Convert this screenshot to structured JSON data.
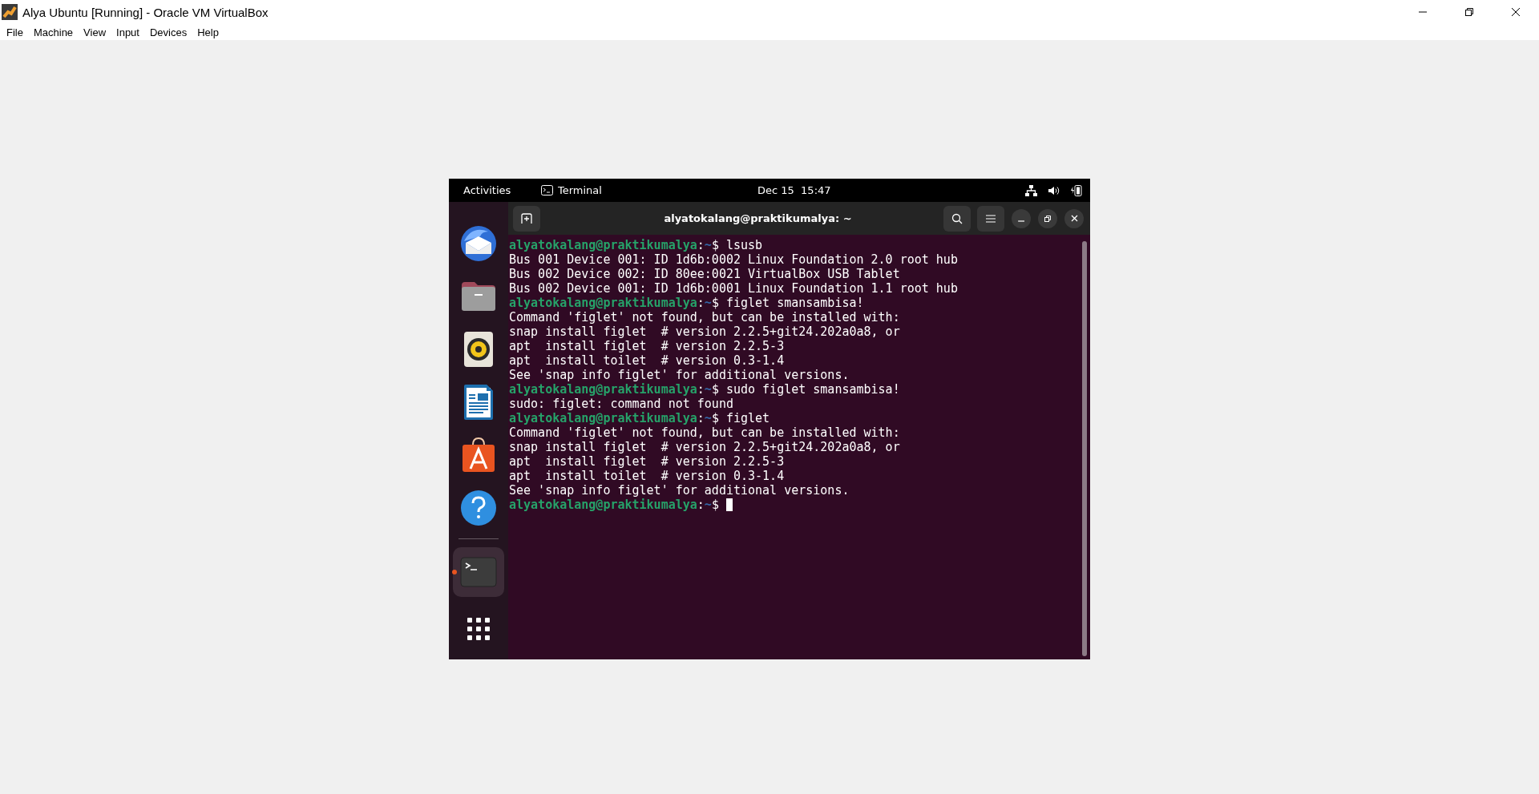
{
  "window": {
    "title": "Alya Ubuntu [Running] - Oracle VM VirtualBox"
  },
  "menu": [
    "File",
    "Machine",
    "View",
    "Input",
    "Devices",
    "Help"
  ],
  "topbar": {
    "activities": "Activities",
    "app": "Terminal",
    "clock": "Dec 15  15:47"
  },
  "dock": [
    {
      "kind": "mail",
      "selected": false
    },
    {
      "kind": "files",
      "selected": false
    },
    {
      "kind": "music",
      "selected": false
    },
    {
      "kind": "writer",
      "selected": false
    },
    {
      "kind": "store",
      "selected": false
    },
    {
      "kind": "help",
      "selected": false
    },
    {
      "kind": "terminal",
      "selected": true
    },
    {
      "kind": "apps",
      "selected": false
    }
  ],
  "terminal": {
    "title": "alyatokalang@praktikumalya: ~",
    "lines": [
      {
        "kind": "prompt",
        "user": "alyatokalang@praktikumalya",
        "sep": ":",
        "path": "~",
        "symbol": "$",
        "command": "lsusb"
      },
      {
        "kind": "output",
        "text": "Bus 001 Device 001: ID 1d6b:0002 Linux Foundation 2.0 root hub"
      },
      {
        "kind": "output",
        "text": "Bus 002 Device 002: ID 80ee:0021 VirtualBox USB Tablet"
      },
      {
        "kind": "output",
        "text": "Bus 002 Device 001: ID 1d6b:0001 Linux Foundation 1.1 root hub"
      },
      {
        "kind": "prompt",
        "user": "alyatokalang@praktikumalya",
        "sep": ":",
        "path": "~",
        "symbol": "$",
        "command": "figlet smansambisa!"
      },
      {
        "kind": "output",
        "text": "Command 'figlet' not found, but can be installed with:"
      },
      {
        "kind": "output",
        "text": "snap install figlet  # version 2.2.5+git24.202a0a8, or"
      },
      {
        "kind": "output",
        "text": "apt  install figlet  # version 2.2.5-3"
      },
      {
        "kind": "output",
        "text": "apt  install toilet  # version 0.3-1.4"
      },
      {
        "kind": "output",
        "text": "See 'snap info figlet' for additional versions."
      },
      {
        "kind": "prompt",
        "user": "alyatokalang@praktikumalya",
        "sep": ":",
        "path": "~",
        "symbol": "$",
        "command": "sudo figlet smansambisa!"
      },
      {
        "kind": "output",
        "text": "sudo: figlet: command not found"
      },
      {
        "kind": "prompt",
        "user": "alyatokalang@praktikumalya",
        "sep": ":",
        "path": "~",
        "symbol": "$",
        "command": "figlet"
      },
      {
        "kind": "output",
        "text": "Command 'figlet' not found, but can be installed with:"
      },
      {
        "kind": "output",
        "text": "snap install figlet  # version 2.2.5+git24.202a0a8, or"
      },
      {
        "kind": "output",
        "text": "apt  install figlet  # version 2.2.5-3"
      },
      {
        "kind": "output",
        "text": "apt  install toilet  # version 0.3-1.4"
      },
      {
        "kind": "output",
        "text": "See 'snap info figlet' for additional versions."
      },
      {
        "kind": "prompt",
        "user": "alyatokalang@praktikumalya",
        "sep": ":",
        "path": "~",
        "symbol": "$",
        "cursor": true
      }
    ]
  }
}
